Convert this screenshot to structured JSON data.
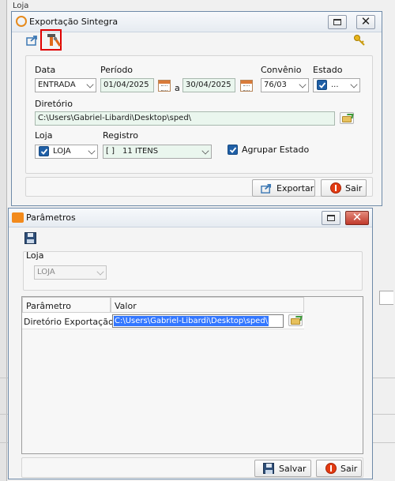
{
  "background": {
    "label": "Loja"
  },
  "export_window": {
    "title": "Exportação Sintegra",
    "toolbar": {
      "export_tool_icon": "export-arrow-icon",
      "tools_icon": "hammer-wrench-icon",
      "key_icon": "key-icon"
    },
    "fields": {
      "data_label": "Data",
      "data_value": "ENTRADA",
      "periodo_label": "Período",
      "periodo_start": "01/04/2025",
      "periodo_sep": "a",
      "periodo_end": "30/04/2025",
      "convenio_label": "Convênio",
      "convenio_value": "76/03",
      "estado_label": "Estado",
      "estado_value": "...",
      "diretorio_label": "Diretório",
      "diretorio_value": "C:\\Users\\Gabriel-Libardi\\Desktop\\sped\\",
      "loja_label": "Loja",
      "loja_value": "LOJA",
      "registro_label": "Registro",
      "registro_prefix": "[ ]",
      "registro_value": "11 ITENS",
      "agrupar_label": "Agrupar Estado"
    },
    "buttons": {
      "exportar": "Exportar",
      "sair": "Sair"
    },
    "accent_highlight": "#e00000"
  },
  "param_window": {
    "title": "Parâmetros",
    "loja_label": "Loja",
    "loja_value": "LOJA",
    "table": {
      "columns": [
        "Parâmetro",
        "Valor"
      ],
      "rows": [
        {
          "parametro": "Diretório Exportação",
          "valor": "C:\\Users\\Gabriel-Libardi\\Desktop\\sped\\"
        }
      ]
    },
    "buttons": {
      "salvar": "Salvar",
      "sair": "Sair"
    }
  }
}
